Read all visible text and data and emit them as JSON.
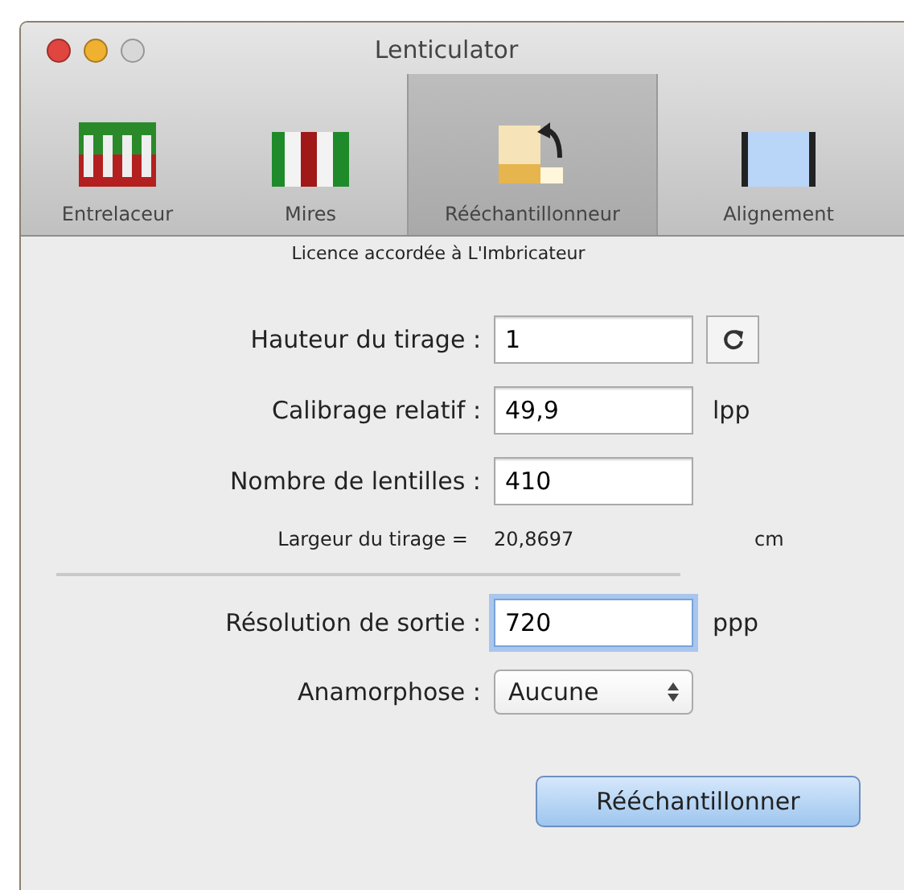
{
  "window": {
    "title": "Lenticulator"
  },
  "toolbar": [
    {
      "label": "Entrelaceur",
      "selected": false
    },
    {
      "label": "Mires",
      "selected": false
    },
    {
      "label": "Rééchantillonneur",
      "selected": true
    },
    {
      "label": "Alignement",
      "selected": false
    }
  ],
  "license": "Licence accordée à L'Imbricateur",
  "fields": [
    {
      "kind": "text",
      "label": "Hauteur du tirage :",
      "value": "1",
      "focused": false,
      "refresh": true
    },
    {
      "kind": "text",
      "label": "Calibrage relatif :",
      "value": "49,9",
      "unit": "lpp",
      "focused": false
    },
    {
      "kind": "text",
      "label": "Nombre de lentilles :",
      "value": "410",
      "focused": false
    },
    {
      "kind": "info",
      "label": "Largeur du tirage =",
      "value": "20,8697",
      "unit": "cm"
    },
    {
      "kind": "divider"
    },
    {
      "kind": "text",
      "label": "Résolution de sortie :",
      "value": "720",
      "unit": "ppp",
      "focused": true
    },
    {
      "kind": "popup",
      "label": "Anamorphose :",
      "value": "Aucune"
    }
  ],
  "action_button": "Rééchantillonner"
}
